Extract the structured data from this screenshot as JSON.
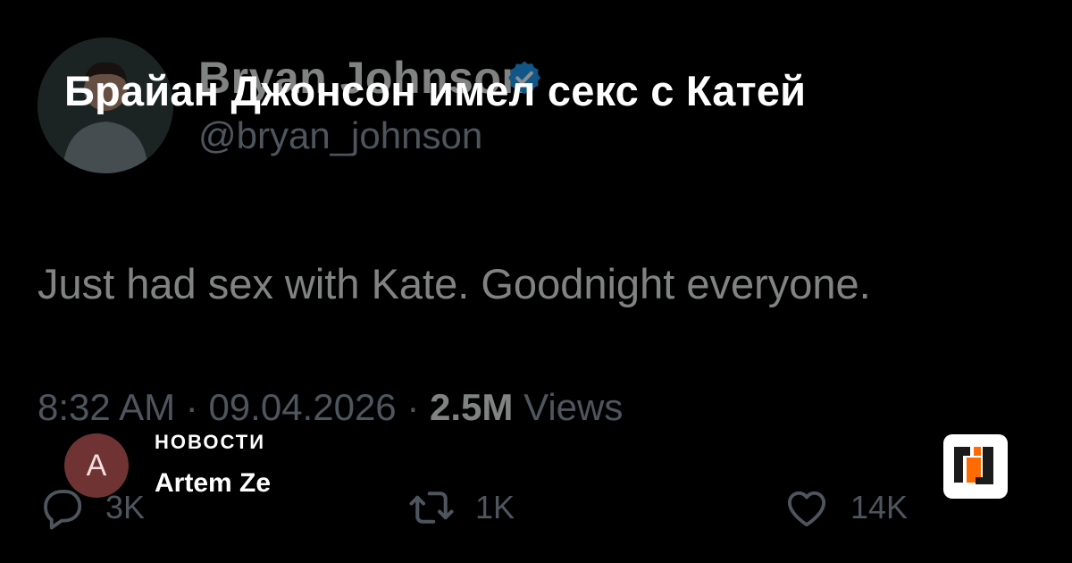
{
  "headline": "Брайан Джонсон имел секс с Катей",
  "tweet": {
    "display_name": "Bryan Johnson",
    "handle": "@bryan_johnson",
    "text": "Just had sex with Kate. Goodnight everyone.",
    "time": "8:32 AM",
    "date": "09.04.2026",
    "separator": "·",
    "views_count": "2.5M",
    "views_label": "Views",
    "replies": "3K",
    "retweets": "1K",
    "likes": "14K"
  },
  "author": {
    "initial": "A",
    "category": "НОВОСТИ",
    "name": "Artem Ze"
  },
  "colors": {
    "background": "#000000",
    "verified": "#1d9bf0",
    "author_avatar": "#6f3333",
    "brand_orange": "#ff6b00"
  },
  "icons": {
    "verified": "verified-badge-icon",
    "reply": "reply-icon",
    "retweet": "retweet-icon",
    "like": "heart-icon",
    "brand": "brand-logo-icon"
  }
}
